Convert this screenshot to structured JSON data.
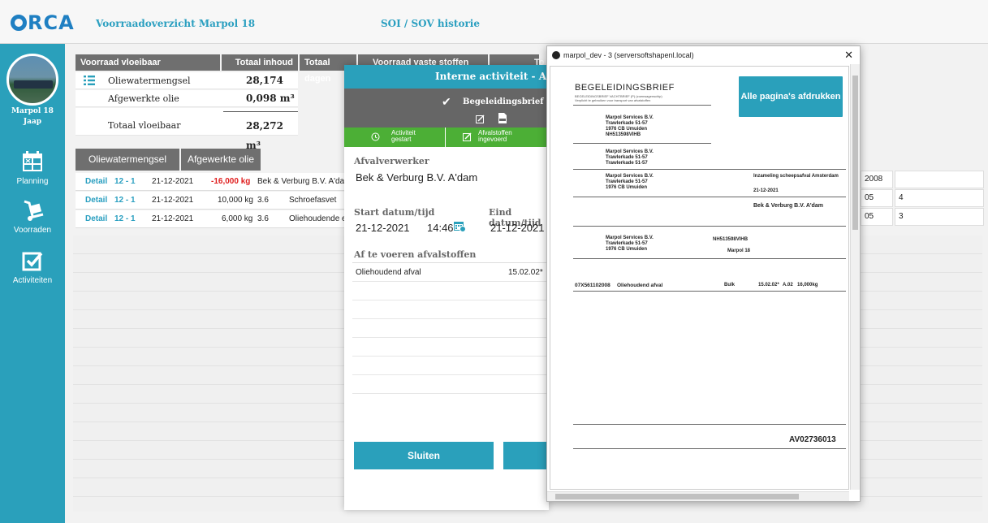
{
  "header": {
    "logo": "RCA",
    "nav_stock": "Voorraadoverzicht Marpol 18",
    "nav_history": "SOI / SOV historie"
  },
  "sidebar": {
    "vessel_name": "Marpol 18",
    "user": "Jaap",
    "items": [
      {
        "label": "Planning",
        "icon": "calendar-icon"
      },
      {
        "label": "Voorraden",
        "icon": "hand-truck-icon"
      },
      {
        "label": "Activiteiten",
        "icon": "checkbox-icon"
      }
    ]
  },
  "stock": {
    "col_liquid": "Voorraad vloeibaar",
    "col_total": "Totaal inhoud",
    "col_days": "Totaal dagen",
    "col_solid": "Voorraad vaste stoffen",
    "col_to": "To",
    "rows": [
      {
        "label": "Oliewatermengsel",
        "value": "28,174 m³"
      },
      {
        "label": "Afgewerkte olie",
        "value": "0,098 m³"
      }
    ],
    "total_label": "Totaal vloeibaar",
    "total_value": "28,272 m³"
  },
  "tabs": [
    "Oliewatermengsel",
    "Afgewerkte olie"
  ],
  "detail_rows": [
    {
      "action": "Detail",
      "period": "12 - 1",
      "date": "21-12-2021",
      "qty": "-16,000 kg",
      "extra": "",
      "name": "Bek & Verburg B.V. A'dam",
      "right1": "2008",
      "right2": ""
    },
    {
      "action": "Detail",
      "period": "12 - 1",
      "date": "21-12-2021",
      "qty": "10,000 kg",
      "extra": "3.6",
      "name": "Schroefasvet",
      "right1": "05",
      "right2": "4"
    },
    {
      "action": "Detail",
      "period": "12 - 1",
      "date": "21-12-2021",
      "qty": "6,000 kg",
      "extra": "3.6",
      "name": "Oliehoudende e",
      "right1": "05",
      "right2": "3"
    }
  ],
  "modal": {
    "title": "Interne activiteit - Afvoe",
    "doc_label": "Begeleidingsbrief",
    "status1": "Activiteit gestart",
    "status2": "Afvalstoffen ingevoerd",
    "processor_label": "Afvalverwerker",
    "processor_value": "Bek & Verburg B.V. A'dam",
    "start_label": "Start datum/tijd",
    "start_date": "21-12-2021",
    "start_time": "14:46",
    "end_label": "Eind datum/tijd",
    "end_date": "21-12-2021",
    "waste_label": "Af te voeren afvalstoffen",
    "waste_name": "Oliehoudend afval",
    "waste_code": "15.02.02*",
    "close_button": "Sluiten"
  },
  "pdf": {
    "window_title": "marpol_dev - 3 (serversoftshapenl.local)",
    "print_button": "Alle pagina's afdrukken",
    "doc_title": "BEGELEIDINGSBRIEF",
    "sender": "Marpol Services B.V.",
    "street": "Trawlerkade 51-57",
    "zip": "1976 CB Umuiden",
    "vihb": "NH513598VIHB",
    "collection": "Inzameling scheepsafval Amsterdam",
    "date": "21-12-2021",
    "receiver": "Bek & Verburg B.V. A'dam",
    "ship": "Marpol 18",
    "waste_code": "07X561102008",
    "waste_name": "Oliehoudend afval",
    "packaging": "Bulk",
    "euralcode": "15.02.02*",
    "proc": "A.02",
    "weight": "16,000kg",
    "doc_number": "AV02736013"
  }
}
